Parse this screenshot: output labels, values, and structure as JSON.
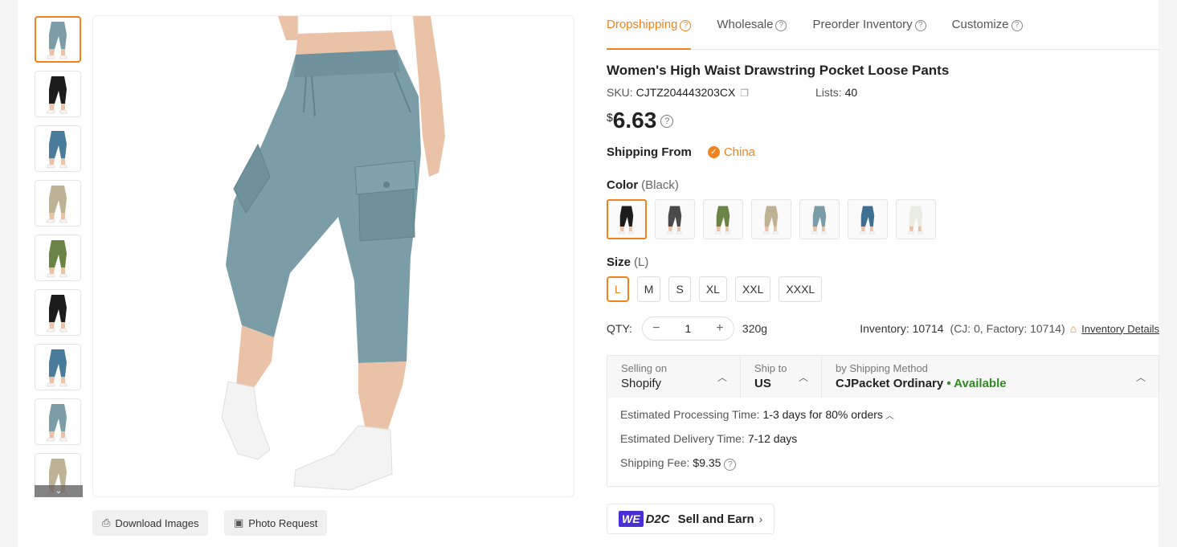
{
  "colors": {
    "accent": "#f0831e",
    "available": "#2e8b1e",
    "product_fabric": "#7a9da7"
  },
  "thumbnails": [
    {
      "fill": "#7a9da7"
    },
    {
      "fill": "#1c1c1c"
    },
    {
      "fill": "#4a7b9a"
    },
    {
      "fill": "#bdb293"
    },
    {
      "fill": "#6b8446"
    },
    {
      "fill": "#1c1c1c"
    },
    {
      "fill": "#4a7b9a"
    },
    {
      "fill": "#7a9da7"
    },
    {
      "fill": "#bdb293"
    }
  ],
  "image_actions": {
    "download": "Download Images",
    "photo_request": "Photo Request"
  },
  "tabs": [
    {
      "label": "Dropshipping"
    },
    {
      "label": "Wholesale"
    },
    {
      "label": "Preorder Inventory"
    },
    {
      "label": "Customize"
    }
  ],
  "product": {
    "title": "Women's High Waist Drawstring Pocket Loose Pants",
    "sku_label": "SKU:",
    "sku": "CJTZ204443203CX",
    "lists_label": "Lists:",
    "lists": "40",
    "currency": "$",
    "price": "6.63"
  },
  "shipping_from": {
    "label": "Shipping From",
    "country": "China"
  },
  "color_option": {
    "label": "Color",
    "selected": "(Black)",
    "swatches": [
      {
        "fill": "#1c1c1c"
      },
      {
        "fill": "#4a4a4a"
      },
      {
        "fill": "#6b8446"
      },
      {
        "fill": "#bdb293"
      },
      {
        "fill": "#7a9da7"
      },
      {
        "fill": "#3f6f93"
      },
      {
        "fill": "#e8ece3"
      }
    ]
  },
  "size_option": {
    "label": "Size",
    "selected": "(L)",
    "sizes": [
      "L",
      "M",
      "S",
      "XL",
      "XXL",
      "XXXL"
    ]
  },
  "quantity": {
    "label": "QTY:",
    "value": "1",
    "weight": "320g",
    "inventory": "Inventory: 10714",
    "inventory_breakdown": "(CJ: 0, Factory: 10714)",
    "details_link": "Inventory Details"
  },
  "shipping": {
    "selling_on_label": "Selling on",
    "selling_on": "Shopify",
    "ship_to_label": "Ship to",
    "ship_to": "US",
    "method_label": "by Shipping Method",
    "method": "CJPacket Ordinary",
    "status": "• Available",
    "processing_label": "Estimated Processing Time:",
    "processing": "1-3 days for 80% orders",
    "delivery_label": "Estimated Delivery Time:",
    "delivery": "7-12 days",
    "fee_label": "Shipping Fee:",
    "fee": "$9.35"
  },
  "d2c": {
    "logo_we": "WE",
    "logo_d2c": "D2C",
    "label": "Sell and Earn"
  }
}
